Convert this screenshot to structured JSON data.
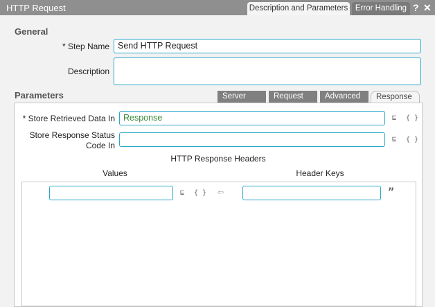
{
  "window": {
    "title": "HTTP Request",
    "tabs": [
      "Description and Parameters",
      "Error Handling"
    ],
    "help_icon": "?",
    "close_icon": "✕"
  },
  "general": {
    "heading": "General",
    "step_name_label": "* Step Name",
    "step_name_value": "Send HTTP Request",
    "description_label": "Description",
    "description_value": ""
  },
  "parameters": {
    "heading": "Parameters",
    "tabs": [
      "Server",
      "Request",
      "Advanced",
      "Response"
    ],
    "active_tab": "Response"
  },
  "response": {
    "store_data_label": "* Store Retrieved Data In",
    "store_data_value": "Response",
    "store_status_label_1": "Store Response Status",
    "store_status_label_2": "Code In",
    "store_status_value": "",
    "headers_title": "HTTP Response Headers",
    "values_header": "Values",
    "keys_header": "Header Keys",
    "value_input": "",
    "key_input": ""
  },
  "icons": {
    "variable": "⊑",
    "braces": "{ }",
    "arrow_left": "⇦",
    "quote": "”"
  }
}
